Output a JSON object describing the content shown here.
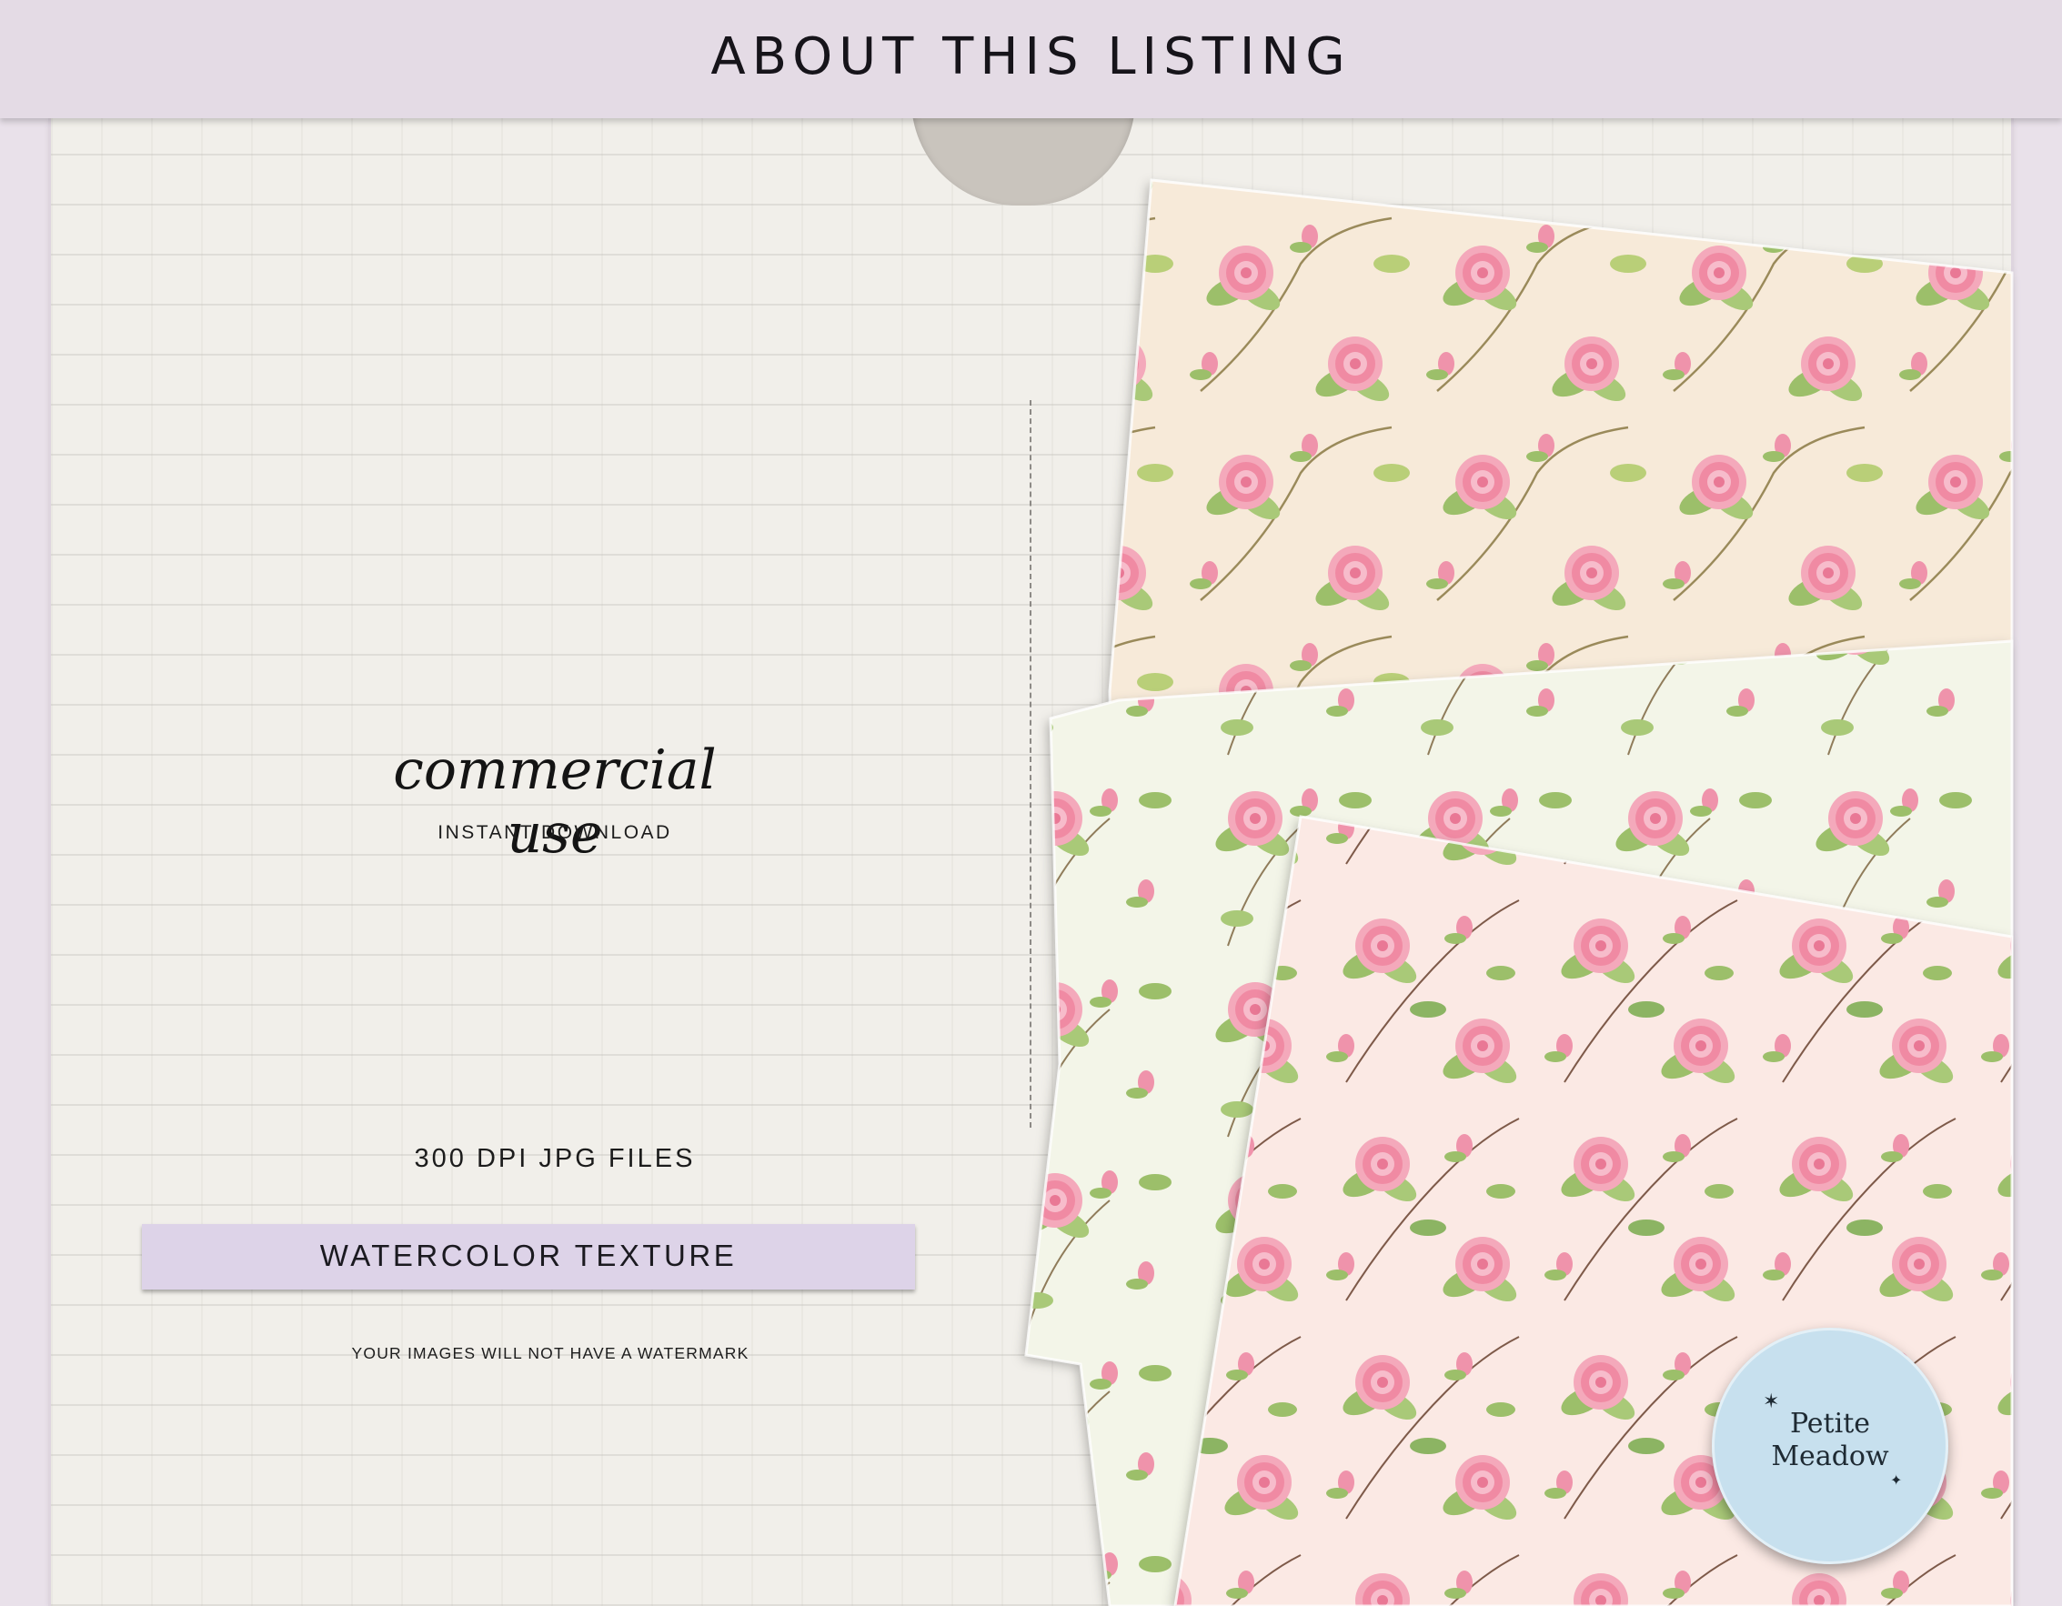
{
  "header": {
    "title": "ABOUT THIS LISTING"
  },
  "left_panel": {
    "script_title": "commercial use",
    "subtitle": "INSTANT DOWNLOAD",
    "file_info": "300 DPI JPG FILES",
    "ribbon_label": "WATERCOLOR TEXTURE",
    "note": "YOUR IMAGES WILL NOT HAVE A WATERMARK"
  },
  "badge": {
    "line1": "Petite",
    "line2": "Meadow"
  },
  "colors": {
    "header": "#e4dbe5",
    "paper_bg": "#f1efea",
    "ribbon": "#ddd3e8",
    "badge": "#c7e0ee",
    "rose_pink": "#f29bb0",
    "leaf_green": "#9cbf6a"
  },
  "icons": [
    "sparkle-icon",
    "rose-pattern"
  ]
}
